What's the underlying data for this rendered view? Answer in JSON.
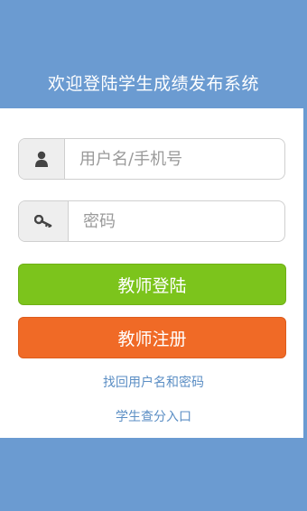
{
  "header": {
    "title": "欢迎登陆学生成绩发布系统"
  },
  "form": {
    "username_placeholder": "用户名/手机号",
    "password_placeholder": "密码",
    "username_icon": "user-icon",
    "password_icon": "key-icon"
  },
  "buttons": {
    "teacher_login": "教师登陆",
    "teacher_register": "教师注册"
  },
  "links": {
    "recover": "找回用户名和密码",
    "student_entry": "学生查分入口"
  },
  "colors": {
    "background": "#6b9bd1",
    "login_button": "#7cc41c",
    "register_button": "#f06a26",
    "link": "#5b8ec4"
  }
}
